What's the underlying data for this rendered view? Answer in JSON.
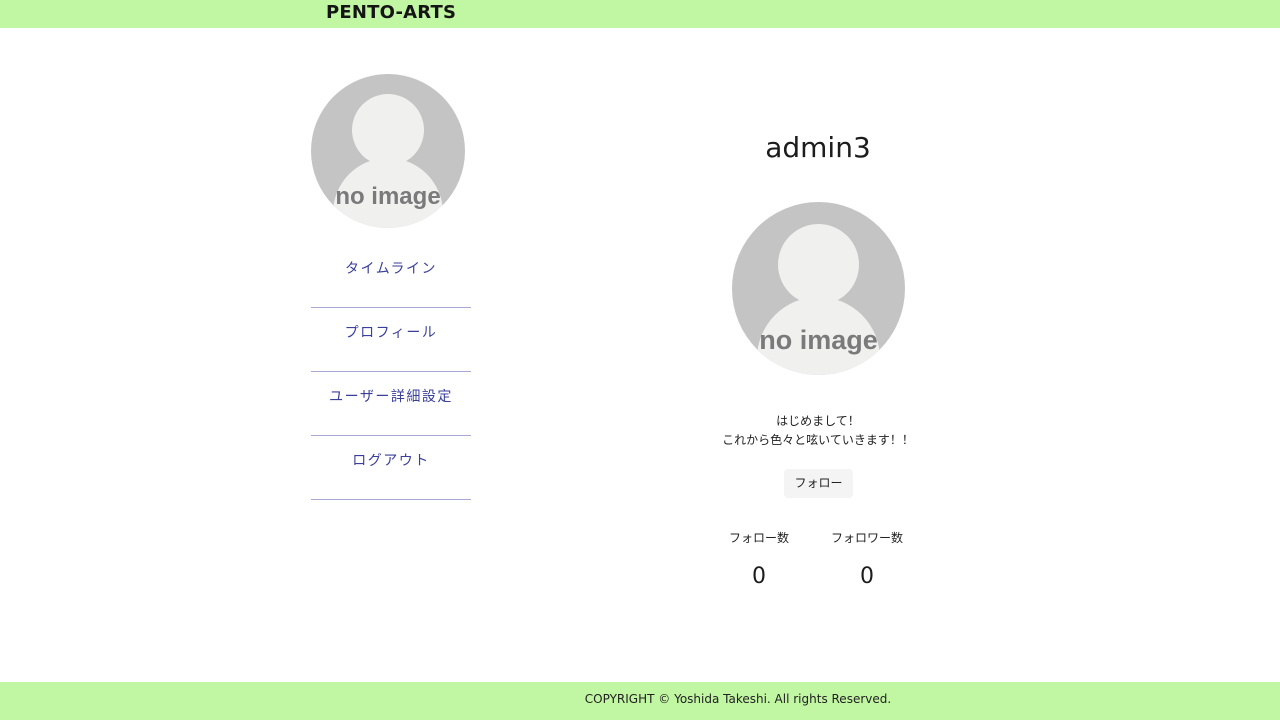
{
  "header": {
    "brand": "PENTO-ARTS",
    "background": "#c1f6a2"
  },
  "sidebar": {
    "avatar": {
      "icon": "default-avatar-icon",
      "placeholder_text": "no image"
    },
    "items": [
      {
        "label": "タイムライン"
      },
      {
        "label": "プロフィール"
      },
      {
        "label": "ユーザー詳細設定"
      },
      {
        "label": "ログアウト"
      }
    ]
  },
  "profile": {
    "username": "admin3",
    "avatar": {
      "icon": "default-avatar-icon",
      "placeholder_text": "no image"
    },
    "bio_lines": [
      "はじめまして！",
      "これから色々と呟いていきます！！"
    ],
    "follow_button_label": "フォロー",
    "stats": {
      "following_label": "フォロー数",
      "following_count": "0",
      "followers_label": "フォロワー数",
      "followers_count": "0"
    }
  },
  "footer": {
    "copyright": "COPYRIGHT © Yoshida Takeshi. All rights Reserved.",
    "background": "#c1f6a2"
  },
  "colors": {
    "nav_text": "#3a3f9c",
    "nav_divider": "#a7a8da"
  }
}
